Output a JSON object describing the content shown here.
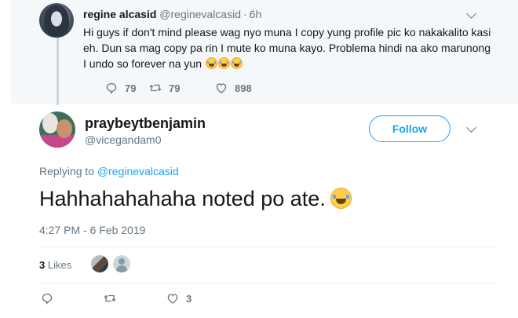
{
  "parent_tweet": {
    "display_name": "regine alcasid",
    "handle": "@reginevalcasid",
    "separator": "·",
    "time": "6h",
    "text": "Hi guys if don't mind please wag nyo muna I copy yung profile pic ko nakakalito kasi eh. Dun sa mag copy pa rin I mute ko muna kayo. Problema hindi na ako marunong I undo so forever na yun",
    "emoji_count": 3,
    "reply_count": "79",
    "retweet_count": "79",
    "like_count": "898",
    "icons": [
      "chevron-down-icon",
      "reply-icon",
      "retweet-icon",
      "heart-icon"
    ]
  },
  "main_tweet": {
    "display_name": "praybeytbenjamin",
    "handle": "@vicegandam0",
    "follow_label": "Follow",
    "replying_prefix": "Replying to",
    "replying_handle": "@reginevalcasid",
    "text": "Hahhahahahaha noted po ate.",
    "timestamp": "4:27 PM - 6 Feb 2019",
    "likes_count": "3",
    "likes_label": "Likes",
    "like_action_count": "3",
    "icons": [
      "chevron-down-icon",
      "reply-icon",
      "retweet-icon",
      "heart-icon",
      "face-with-tears-of-joy-emoji"
    ]
  },
  "colors": {
    "accent": "#1da1f2",
    "muted_text": "#657786",
    "parent_background": "#f5f8fa",
    "border": "#e6ecf0"
  }
}
